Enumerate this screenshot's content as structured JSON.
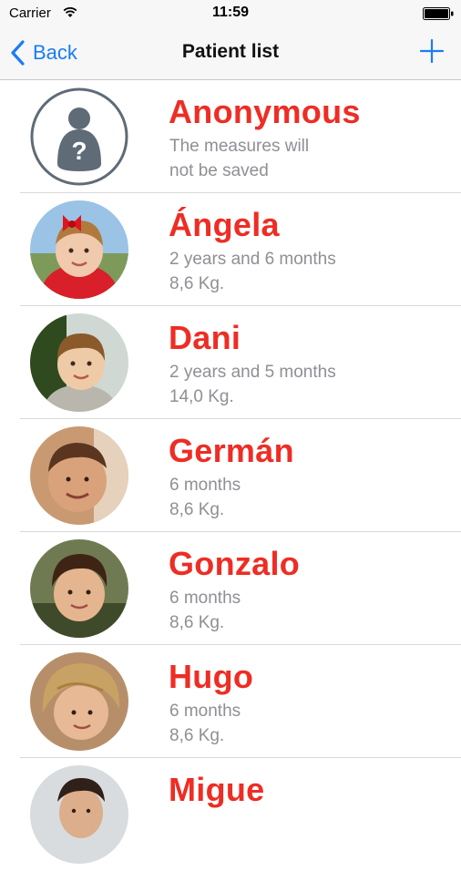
{
  "status_bar": {
    "carrier": "Carrier",
    "time": "11:59"
  },
  "nav": {
    "back_label": "Back",
    "title": "Patient list"
  },
  "colors": {
    "accent": "#1a7cf5",
    "name": "#ee2d24",
    "detail": "#8f8f95"
  },
  "patients": [
    {
      "name": "Anonymous",
      "line1": "The measures will",
      "line2": "not be saved",
      "avatar": "anonymous-user-icon"
    },
    {
      "name": "Ángela",
      "line1": "2 years and 6 months",
      "line2": "8,6 Kg.",
      "avatar": "photo"
    },
    {
      "name": "Dani",
      "line1": "2 years and 5 months",
      "line2": "14,0 Kg.",
      "avatar": "photo"
    },
    {
      "name": "Germán",
      "line1": "6 months",
      "line2": "8,6 Kg.",
      "avatar": "photo"
    },
    {
      "name": "Gonzalo",
      "line1": "6 months",
      "line2": "8,6 Kg.",
      "avatar": "photo"
    },
    {
      "name": "Hugo",
      "line1": "6 months",
      "line2": "8,6 Kg.",
      "avatar": "photo"
    },
    {
      "name": "Migue",
      "line1": "",
      "line2": "",
      "avatar": "photo"
    }
  ]
}
